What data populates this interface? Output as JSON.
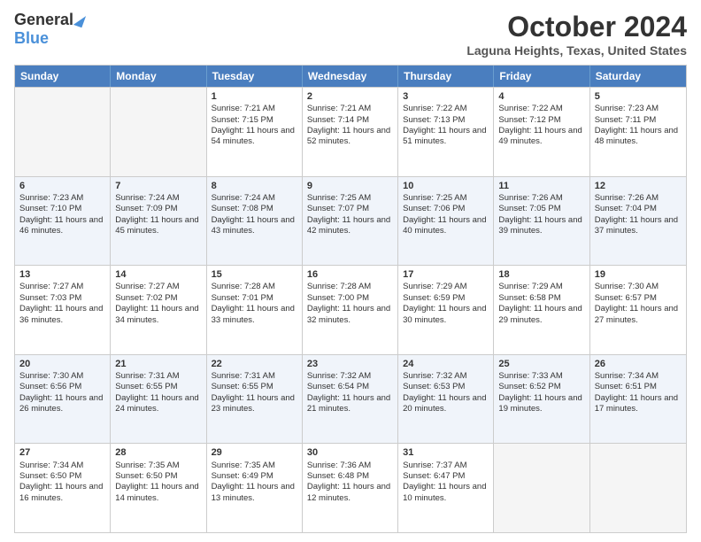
{
  "logo": {
    "general": "General",
    "blue": "Blue"
  },
  "title": "October 2024",
  "location": "Laguna Heights, Texas, United States",
  "days_of_week": [
    "Sunday",
    "Monday",
    "Tuesday",
    "Wednesday",
    "Thursday",
    "Friday",
    "Saturday"
  ],
  "weeks": [
    [
      {
        "day": "",
        "sunrise": "",
        "sunset": "",
        "daylight": ""
      },
      {
        "day": "",
        "sunrise": "",
        "sunset": "",
        "daylight": ""
      },
      {
        "day": "1",
        "sunrise": "Sunrise: 7:21 AM",
        "sunset": "Sunset: 7:15 PM",
        "daylight": "Daylight: 11 hours and 54 minutes."
      },
      {
        "day": "2",
        "sunrise": "Sunrise: 7:21 AM",
        "sunset": "Sunset: 7:14 PM",
        "daylight": "Daylight: 11 hours and 52 minutes."
      },
      {
        "day": "3",
        "sunrise": "Sunrise: 7:22 AM",
        "sunset": "Sunset: 7:13 PM",
        "daylight": "Daylight: 11 hours and 51 minutes."
      },
      {
        "day": "4",
        "sunrise": "Sunrise: 7:22 AM",
        "sunset": "Sunset: 7:12 PM",
        "daylight": "Daylight: 11 hours and 49 minutes."
      },
      {
        "day": "5",
        "sunrise": "Sunrise: 7:23 AM",
        "sunset": "Sunset: 7:11 PM",
        "daylight": "Daylight: 11 hours and 48 minutes."
      }
    ],
    [
      {
        "day": "6",
        "sunrise": "Sunrise: 7:23 AM",
        "sunset": "Sunset: 7:10 PM",
        "daylight": "Daylight: 11 hours and 46 minutes."
      },
      {
        "day": "7",
        "sunrise": "Sunrise: 7:24 AM",
        "sunset": "Sunset: 7:09 PM",
        "daylight": "Daylight: 11 hours and 45 minutes."
      },
      {
        "day": "8",
        "sunrise": "Sunrise: 7:24 AM",
        "sunset": "Sunset: 7:08 PM",
        "daylight": "Daylight: 11 hours and 43 minutes."
      },
      {
        "day": "9",
        "sunrise": "Sunrise: 7:25 AM",
        "sunset": "Sunset: 7:07 PM",
        "daylight": "Daylight: 11 hours and 42 minutes."
      },
      {
        "day": "10",
        "sunrise": "Sunrise: 7:25 AM",
        "sunset": "Sunset: 7:06 PM",
        "daylight": "Daylight: 11 hours and 40 minutes."
      },
      {
        "day": "11",
        "sunrise": "Sunrise: 7:26 AM",
        "sunset": "Sunset: 7:05 PM",
        "daylight": "Daylight: 11 hours and 39 minutes."
      },
      {
        "day": "12",
        "sunrise": "Sunrise: 7:26 AM",
        "sunset": "Sunset: 7:04 PM",
        "daylight": "Daylight: 11 hours and 37 minutes."
      }
    ],
    [
      {
        "day": "13",
        "sunrise": "Sunrise: 7:27 AM",
        "sunset": "Sunset: 7:03 PM",
        "daylight": "Daylight: 11 hours and 36 minutes."
      },
      {
        "day": "14",
        "sunrise": "Sunrise: 7:27 AM",
        "sunset": "Sunset: 7:02 PM",
        "daylight": "Daylight: 11 hours and 34 minutes."
      },
      {
        "day": "15",
        "sunrise": "Sunrise: 7:28 AM",
        "sunset": "Sunset: 7:01 PM",
        "daylight": "Daylight: 11 hours and 33 minutes."
      },
      {
        "day": "16",
        "sunrise": "Sunrise: 7:28 AM",
        "sunset": "Sunset: 7:00 PM",
        "daylight": "Daylight: 11 hours and 32 minutes."
      },
      {
        "day": "17",
        "sunrise": "Sunrise: 7:29 AM",
        "sunset": "Sunset: 6:59 PM",
        "daylight": "Daylight: 11 hours and 30 minutes."
      },
      {
        "day": "18",
        "sunrise": "Sunrise: 7:29 AM",
        "sunset": "Sunset: 6:58 PM",
        "daylight": "Daylight: 11 hours and 29 minutes."
      },
      {
        "day": "19",
        "sunrise": "Sunrise: 7:30 AM",
        "sunset": "Sunset: 6:57 PM",
        "daylight": "Daylight: 11 hours and 27 minutes."
      }
    ],
    [
      {
        "day": "20",
        "sunrise": "Sunrise: 7:30 AM",
        "sunset": "Sunset: 6:56 PM",
        "daylight": "Daylight: 11 hours and 26 minutes."
      },
      {
        "day": "21",
        "sunrise": "Sunrise: 7:31 AM",
        "sunset": "Sunset: 6:55 PM",
        "daylight": "Daylight: 11 hours and 24 minutes."
      },
      {
        "day": "22",
        "sunrise": "Sunrise: 7:31 AM",
        "sunset": "Sunset: 6:55 PM",
        "daylight": "Daylight: 11 hours and 23 minutes."
      },
      {
        "day": "23",
        "sunrise": "Sunrise: 7:32 AM",
        "sunset": "Sunset: 6:54 PM",
        "daylight": "Daylight: 11 hours and 21 minutes."
      },
      {
        "day": "24",
        "sunrise": "Sunrise: 7:32 AM",
        "sunset": "Sunset: 6:53 PM",
        "daylight": "Daylight: 11 hours and 20 minutes."
      },
      {
        "day": "25",
        "sunrise": "Sunrise: 7:33 AM",
        "sunset": "Sunset: 6:52 PM",
        "daylight": "Daylight: 11 hours and 19 minutes."
      },
      {
        "day": "26",
        "sunrise": "Sunrise: 7:34 AM",
        "sunset": "Sunset: 6:51 PM",
        "daylight": "Daylight: 11 hours and 17 minutes."
      }
    ],
    [
      {
        "day": "27",
        "sunrise": "Sunrise: 7:34 AM",
        "sunset": "Sunset: 6:50 PM",
        "daylight": "Daylight: 11 hours and 16 minutes."
      },
      {
        "day": "28",
        "sunrise": "Sunrise: 7:35 AM",
        "sunset": "Sunset: 6:50 PM",
        "daylight": "Daylight: 11 hours and 14 minutes."
      },
      {
        "day": "29",
        "sunrise": "Sunrise: 7:35 AM",
        "sunset": "Sunset: 6:49 PM",
        "daylight": "Daylight: 11 hours and 13 minutes."
      },
      {
        "day": "30",
        "sunrise": "Sunrise: 7:36 AM",
        "sunset": "Sunset: 6:48 PM",
        "daylight": "Daylight: 11 hours and 12 minutes."
      },
      {
        "day": "31",
        "sunrise": "Sunrise: 7:37 AM",
        "sunset": "Sunset: 6:47 PM",
        "daylight": "Daylight: 11 hours and 10 minutes."
      },
      {
        "day": "",
        "sunrise": "",
        "sunset": "",
        "daylight": ""
      },
      {
        "day": "",
        "sunrise": "",
        "sunset": "",
        "daylight": ""
      }
    ]
  ]
}
